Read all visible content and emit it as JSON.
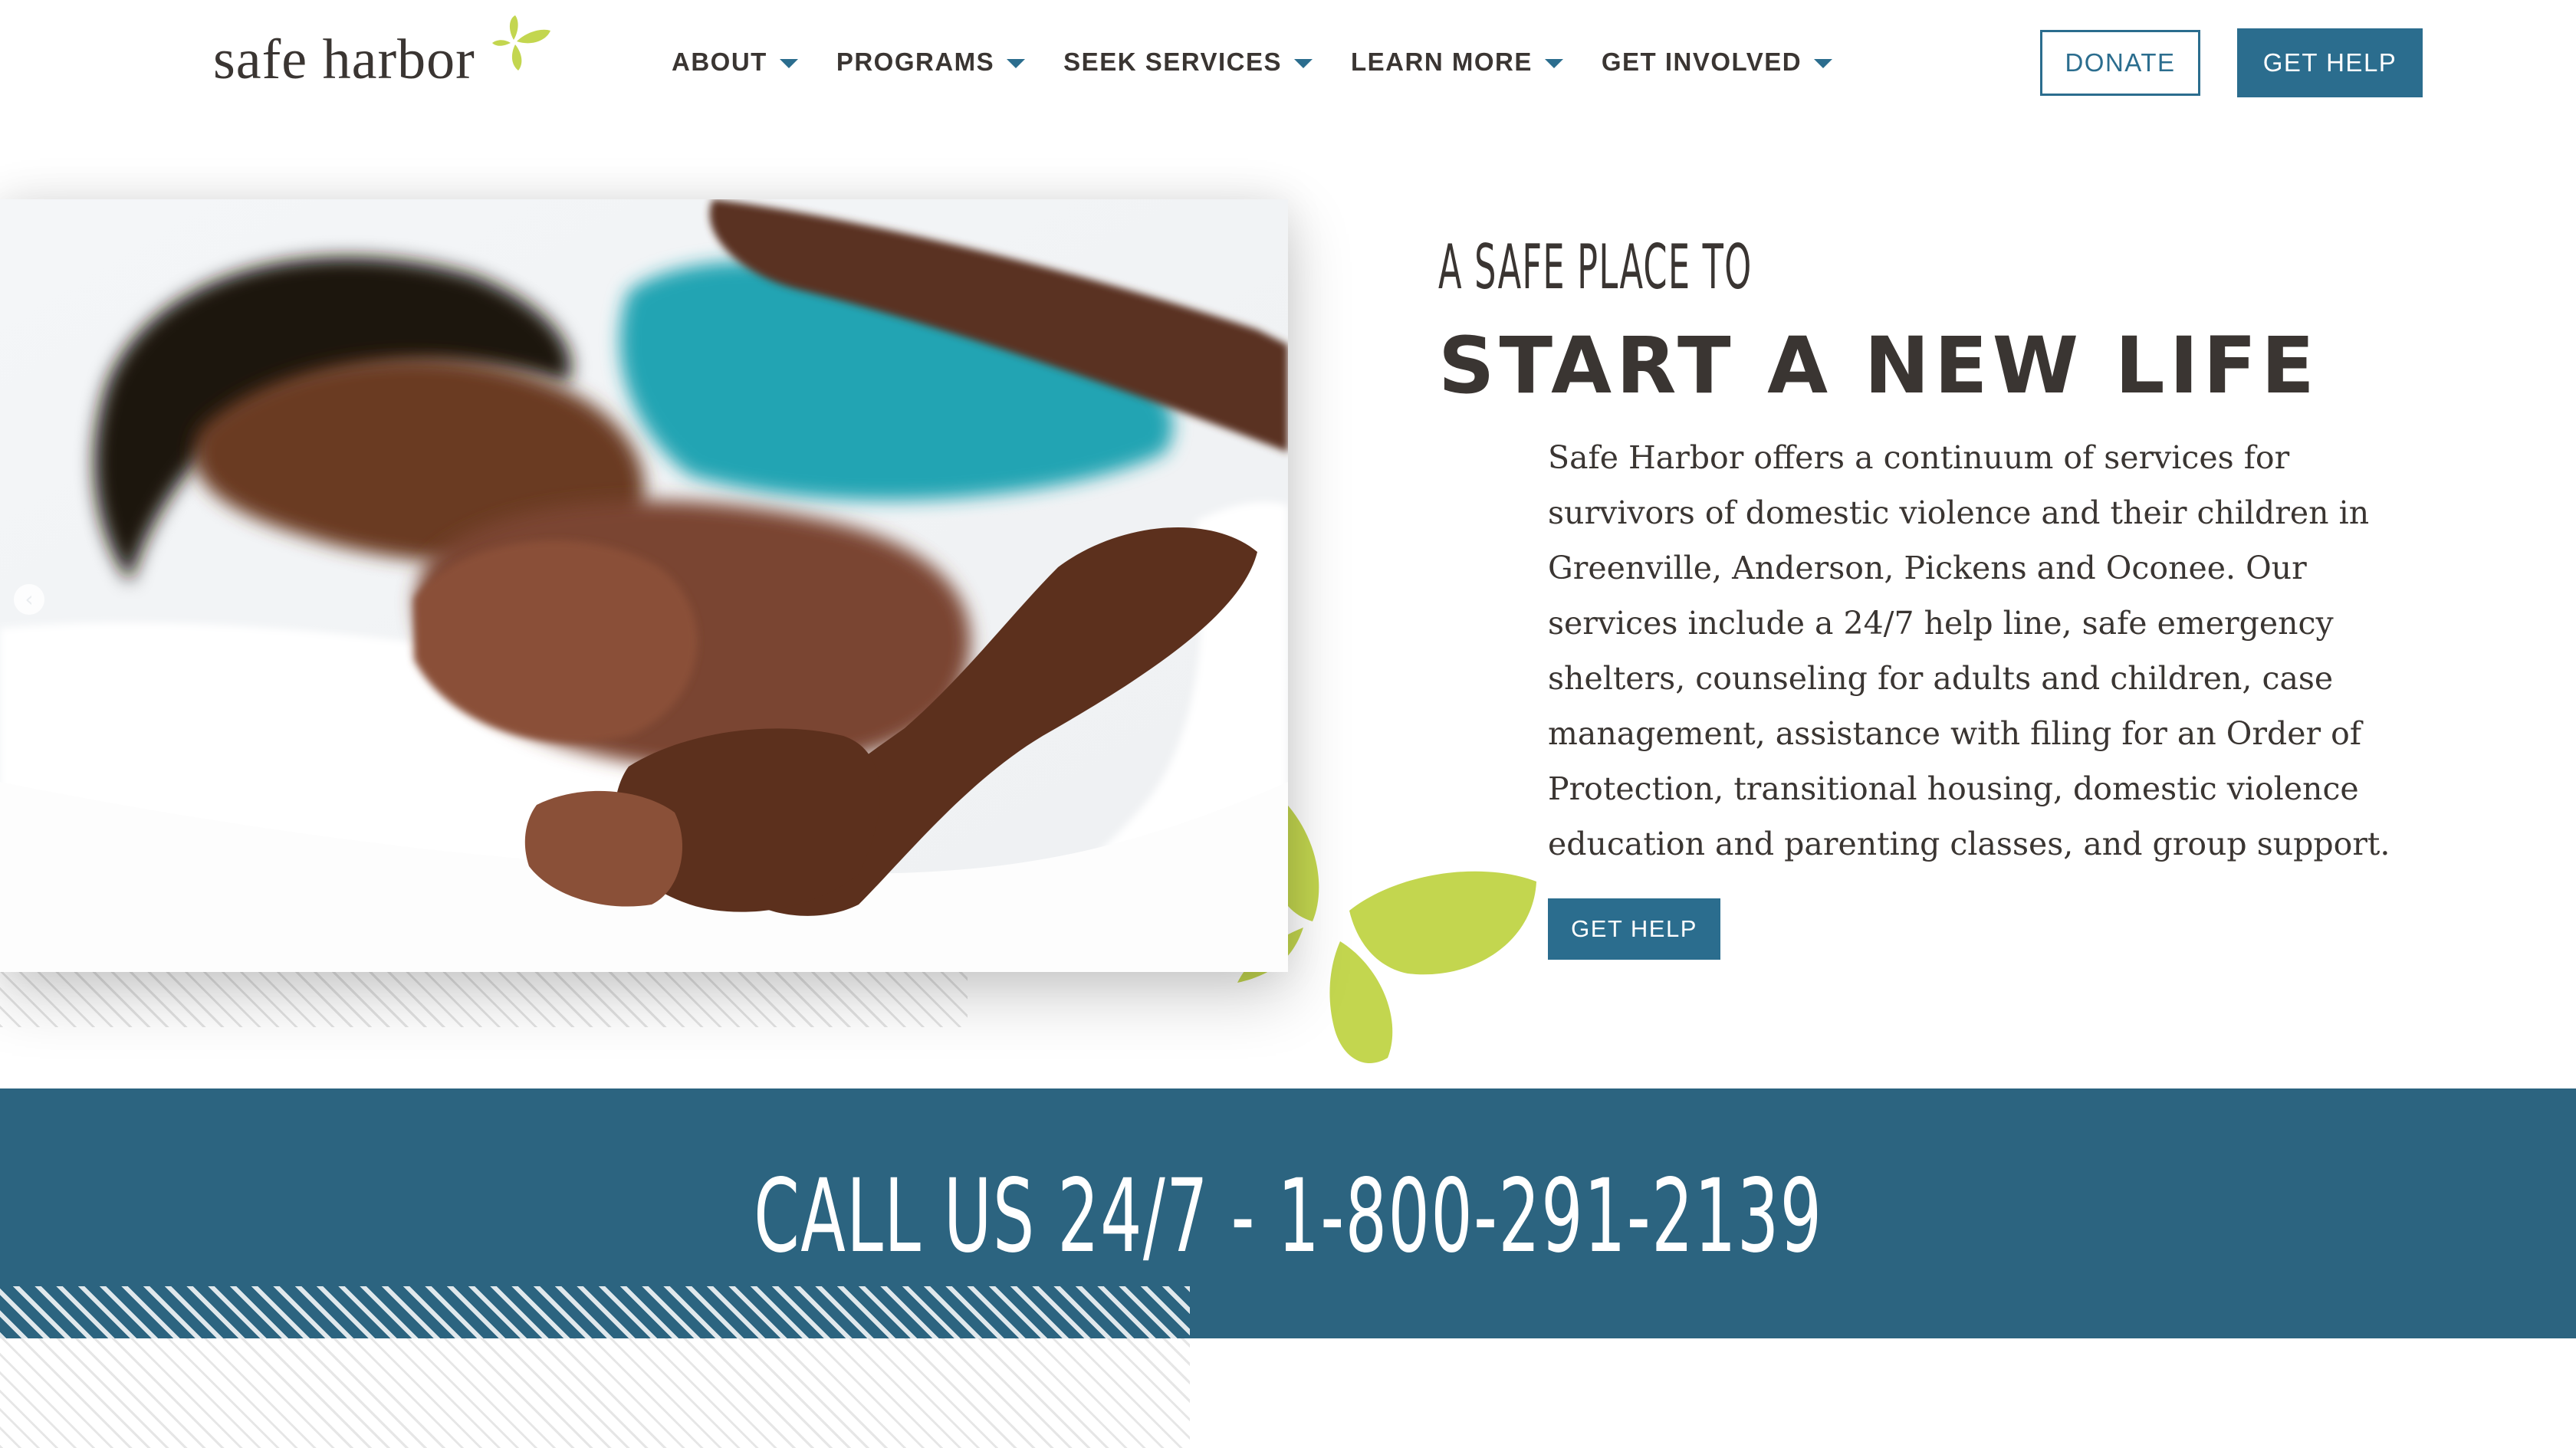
{
  "header": {
    "logo_text": "safe harbor",
    "nav": [
      {
        "label": "ABOUT"
      },
      {
        "label": "PROGRAMS"
      },
      {
        "label": "SEEK SERVICES"
      },
      {
        "label": "LEARN MORE"
      },
      {
        "label": "GET INVOLVED"
      }
    ],
    "donate_label": "DONATE",
    "get_help_label": "GET HELP"
  },
  "hero": {
    "image_alt": "Mother and baby sleeping on white bedding",
    "heading_small": "A SAFE PLACE TO",
    "heading_large": "START A NEW LIFE",
    "body": "Safe Harbor offers a continuum of services for survivors of domestic violence and their children in Greenville, Anderson, Pickens and Oconee. Our services include a 24/7 help line, safe emergency shelters, counseling for adults and children, case management, assistance with filing for an Order of Protection, transitional housing, domestic violence education and parenting classes, and group support.",
    "cta_label": "GET HELP",
    "prev_icon": "chevron-left-icon"
  },
  "call_band": {
    "text": "CALL US 24/7 - 1-800-291-2139"
  },
  "colors": {
    "brand_blue": "#2b6d8e",
    "band_blue": "#2c6480",
    "accent_green": "#c3d64f",
    "text_dark": "#3a3532"
  }
}
